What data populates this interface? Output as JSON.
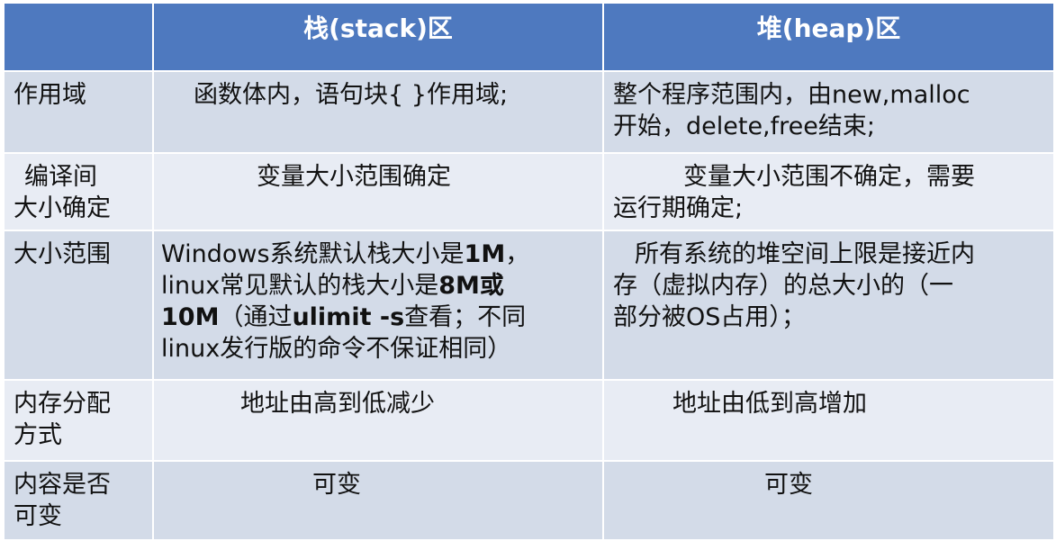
{
  "header": {
    "corner": "",
    "stack": "栈(stack)区",
    "heap": "堆(heap)区"
  },
  "rows": [
    {
      "label_lines": [
        "作用域"
      ],
      "stack_lines": [
        "函数体内，语句块{ }作用域;"
      ],
      "heap_lines": [
        "整个程序范围内，由new,malloc",
        "开始，delete,free结束;"
      ]
    },
    {
      "label_lines": [
        "编译间",
        "大小确定"
      ],
      "stack_lines": [
        "变量大小范围确定"
      ],
      "heap_lines": [
        "变量大小范围不确定，需要",
        "运行期确定;"
      ]
    },
    {
      "label_lines": [
        "大小范围"
      ],
      "stack": {
        "l1_a": "Windows系统默认栈大小是",
        "l1_b": "1M",
        "l1_c": "，",
        "l2_a": "linux常见默认的栈大小是",
        "l2_b": "8M或",
        "l3_a": "10M",
        "l3_b": "（通过",
        "l3_c": "ulimit -s",
        "l3_d": "查看；不同",
        "l4": "linux发行版的命令不保证相同）"
      },
      "heap_lines": [
        "所有系统的堆空间上限是接近内",
        "存（虚拟内存）的总大小的（一",
        "部分被OS占用）；"
      ]
    },
    {
      "label_lines": [
        "内存分配",
        "方式"
      ],
      "stack_lines": [
        "地址由高到低减少"
      ],
      "heap_lines": [
        "地址由低到高增加"
      ]
    },
    {
      "label_lines": [
        "内容是否",
        "可变"
      ],
      "stack_lines": [
        "可变"
      ],
      "heap_lines": [
        "可变"
      ]
    }
  ]
}
